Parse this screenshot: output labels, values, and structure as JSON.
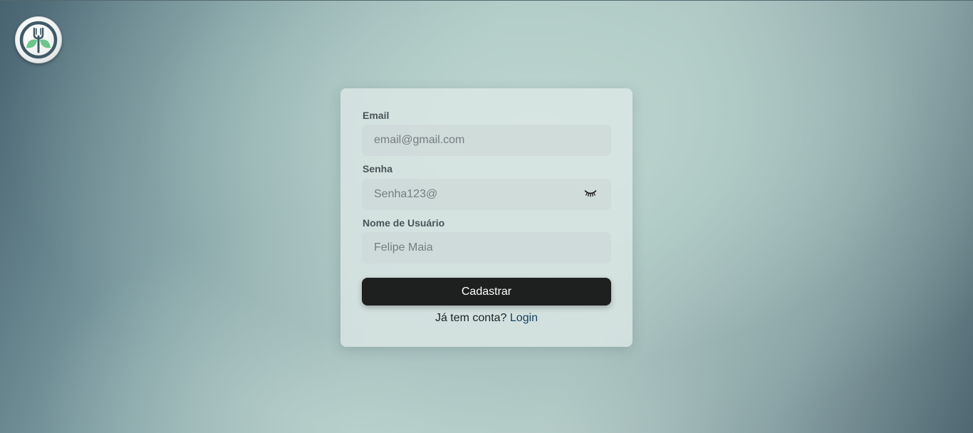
{
  "logo": {
    "icon": "fork-leaves-logo-icon",
    "colors": {
      "ring": "#3f5a66",
      "leaf": "#6cc58a",
      "fork": "#ffffff"
    }
  },
  "form": {
    "email": {
      "label": "Email",
      "placeholder": "email@gmail.com",
      "value": ""
    },
    "password": {
      "label": "Senha",
      "placeholder": "Senha123@",
      "value": "",
      "toggle_icon": "eye-closed-icon"
    },
    "username": {
      "label": "Nome de Usuário",
      "placeholder": "Felipe Maia",
      "value": ""
    },
    "submit_label": "Cadastrar",
    "footer": {
      "prompt": "Já tem conta?",
      "link_label": "Login"
    }
  },
  "colors": {
    "button_bg": "#1e1f1f",
    "link": "#163f5c",
    "label": "#4a5458"
  }
}
